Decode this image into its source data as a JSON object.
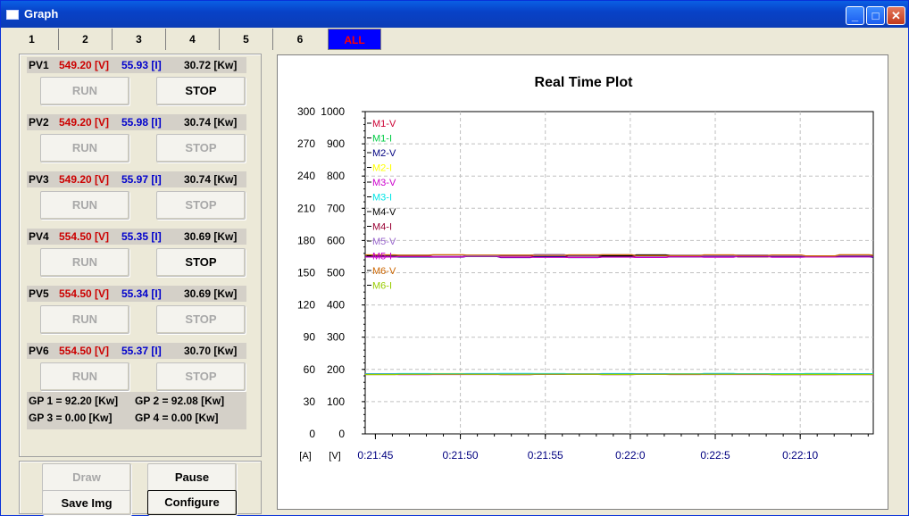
{
  "window": {
    "title": "Graph"
  },
  "tabs": [
    "1",
    "2",
    "3",
    "4",
    "5",
    "6",
    "ALL"
  ],
  "pv_rows": [
    {
      "name": "PV1",
      "voltage": "549.20 [V]",
      "current": "55.93 [I]",
      "power": "30.72 [Kw]",
      "run": "RUN",
      "stop": "STOP",
      "run_enabled": false,
      "stop_enabled": true
    },
    {
      "name": "PV2",
      "voltage": "549.20 [V]",
      "current": "55.98 [I]",
      "power": "30.74 [Kw]",
      "run": "RUN",
      "stop": "STOP",
      "run_enabled": false,
      "stop_enabled": false
    },
    {
      "name": "PV3",
      "voltage": "549.20 [V]",
      "current": "55.97 [I]",
      "power": "30.74 [Kw]",
      "run": "RUN",
      "stop": "STOP",
      "run_enabled": false,
      "stop_enabled": false
    },
    {
      "name": "PV4",
      "voltage": "554.50 [V]",
      "current": "55.35 [I]",
      "power": "30.69 [Kw]",
      "run": "RUN",
      "stop": "STOP",
      "run_enabled": false,
      "stop_enabled": true
    },
    {
      "name": "PV5",
      "voltage": "554.50 [V]",
      "current": "55.34 [I]",
      "power": "30.69 [Kw]",
      "run": "RUN",
      "stop": "STOP",
      "run_enabled": false,
      "stop_enabled": false
    },
    {
      "name": "PV6",
      "voltage": "554.50 [V]",
      "current": "55.37 [I]",
      "power": "30.70 [Kw]",
      "run": "RUN",
      "stop": "STOP",
      "run_enabled": false,
      "stop_enabled": false
    }
  ],
  "gp": {
    "gp1": "GP 1 = 92.20 [Kw]",
    "gp2": "GP 2 = 92.08 [Kw]",
    "gp3": "GP 3 = 0.00 [Kw]",
    "gp4": "GP 4 = 0.00 [Kw]"
  },
  "controls": {
    "draw": "Draw",
    "pause": "Pause",
    "save_img": "Save Img",
    "configure": "Configure"
  },
  "colors": {
    "voltage": "#cc0000",
    "current": "#0000cc",
    "active_tab_bg": "#0000ff",
    "active_tab_fg": "#ff0000"
  },
  "chart_data": {
    "type": "line",
    "title": "Real Time Plot",
    "xlabel": "",
    "ylabel_current_unit": "[A]",
    "ylabel_voltage_unit": "[V]",
    "x_ticks": [
      "0:21:45",
      "0:21:50",
      "0:21:55",
      "0:22:0",
      "0:22:5",
      "0:22:10"
    ],
    "y_ticks_current": [
      "0",
      "30",
      "60",
      "90",
      "120",
      "150",
      "180",
      "210",
      "240",
      "270",
      "300"
    ],
    "y_ticks_voltage": [
      "0",
      "100",
      "200",
      "300",
      "400",
      "500",
      "600",
      "700",
      "800",
      "900",
      "1000"
    ],
    "ylim_current": [
      0,
      300
    ],
    "ylim_voltage": [
      0,
      1000
    ],
    "x_range_seconds": [
      1304.4,
      1334.3
    ],
    "grid": true,
    "legend_position": "top-left",
    "series": [
      {
        "name": "M1-V",
        "color": "#cc0033",
        "axis": "voltage",
        "value": 551
      },
      {
        "name": "M1-I",
        "color": "#00cc44",
        "axis": "current",
        "value": 55.9
      },
      {
        "name": "M2-V",
        "color": "#000080",
        "axis": "voltage",
        "value": 549
      },
      {
        "name": "M2-I",
        "color": "#ffff00",
        "axis": "current",
        "value": 55.9
      },
      {
        "name": "M3-V",
        "color": "#cc00cc",
        "axis": "voltage",
        "value": 549
      },
      {
        "name": "M3-I",
        "color": "#00e5e5",
        "axis": "current",
        "value": 56.0
      },
      {
        "name": "M4-V",
        "color": "#000000",
        "axis": "voltage",
        "value": 554
      },
      {
        "name": "M4-I",
        "color": "#990033",
        "axis": "current",
        "value": 55.3
      },
      {
        "name": "M5-V",
        "color": "#9966cc",
        "axis": "voltage",
        "value": 554
      },
      {
        "name": "M5-I",
        "color": "#cc00cc",
        "axis": "current",
        "value": 55.3
      },
      {
        "name": "M6-V",
        "color": "#cc6600",
        "axis": "voltage",
        "value": 554
      },
      {
        "name": "M6-I",
        "color": "#99cc00",
        "axis": "current",
        "value": 55.4
      }
    ]
  }
}
